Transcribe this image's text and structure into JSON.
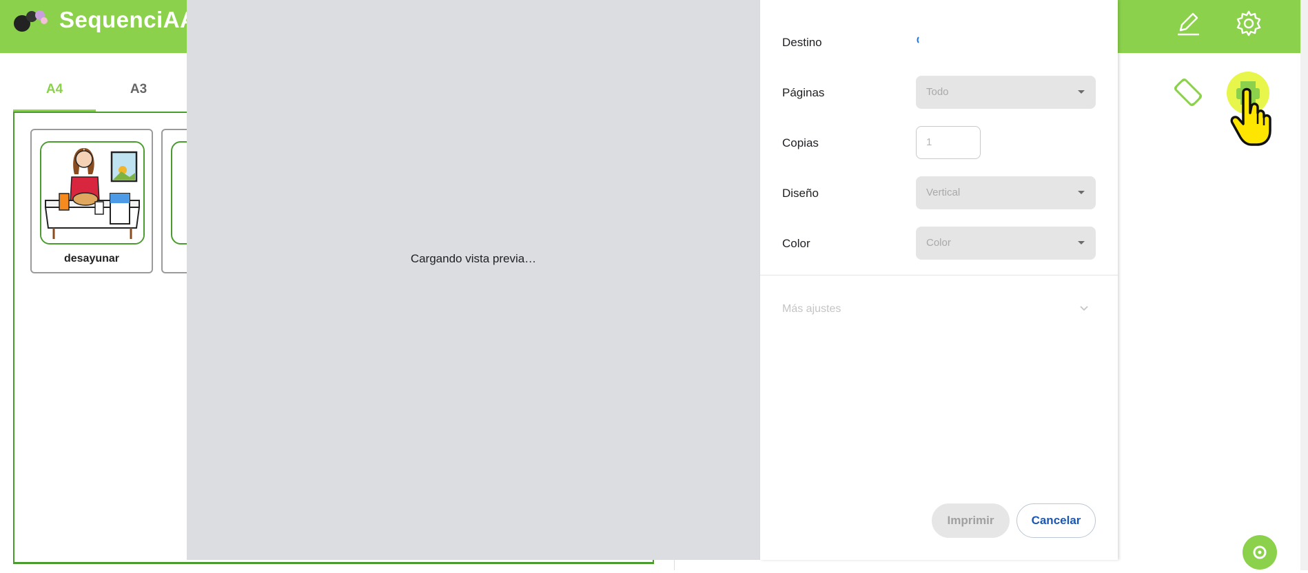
{
  "app": {
    "title": "SequenciAAC",
    "header_color": "#8bd14b"
  },
  "tabs": [
    {
      "label": "A4",
      "active": true
    },
    {
      "label": "A3",
      "active": false
    }
  ],
  "cards": [
    {
      "label": "desayunar"
    }
  ],
  "icons": {
    "edit": "pencil-icon",
    "settings": "gear-icon",
    "rotate": "rotate-screen-icon",
    "print": "printer-icon",
    "fab": "chat-icon"
  },
  "print_dialog": {
    "preview_message": "Cargando vista previa…",
    "destination_label": "Destino",
    "pages_label": "Páginas",
    "pages_value": "Todo",
    "copies_label": "Copias",
    "copies_value": "1",
    "layout_label": "Diseño",
    "layout_value": "Vertical",
    "color_label": "Color",
    "color_value": "Color",
    "more_settings": "Más ajustes",
    "print_button": "Imprimir",
    "cancel_button": "Cancelar"
  }
}
